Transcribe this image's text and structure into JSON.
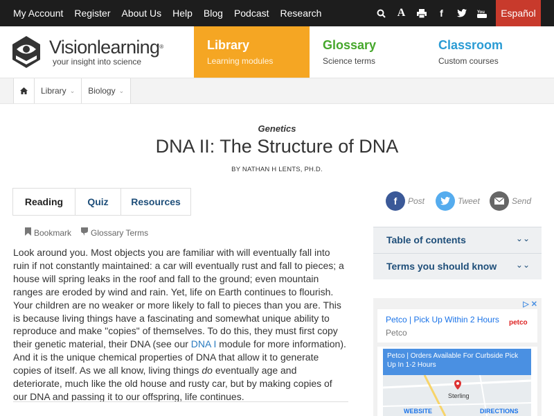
{
  "topnav": {
    "items": [
      "My Account",
      "Register",
      "About Us",
      "Help",
      "Blog",
      "Podcast",
      "Research"
    ],
    "icons": [
      "search-icon",
      "text-size-icon",
      "print-icon",
      "facebook-icon",
      "twitter-icon",
      "youtube-icon"
    ],
    "language_button": "Español"
  },
  "header": {
    "brand": "Visionlearning",
    "tagline": "your insight into science",
    "nav": [
      {
        "title": "Library",
        "subtitle": "Learning modules"
      },
      {
        "title": "Glossary",
        "subtitle": "Science terms"
      },
      {
        "title": "Classroom",
        "subtitle": "Custom courses"
      }
    ],
    "colors": {
      "library": "#f5a623",
      "glossary": "#45a72b",
      "classroom": "#2a9bd4"
    }
  },
  "breadcrumb": [
    "Library",
    "Biology"
  ],
  "article": {
    "category": "Genetics",
    "title": "DNA II: The Structure of DNA",
    "byline": "BY NATHAN H LENTS, PH.D.",
    "tabs": [
      "Reading",
      "Quiz",
      "Resources"
    ],
    "tools": [
      "Bookmark",
      "Glossary Terms"
    ],
    "body_before_link": "Look around you. Most objects you are familiar with will eventually fall into ruin if not constantly maintained: a car will eventually rust and fall to pieces; a house will spring leaks in the roof and fall to the ground; even mountain ranges are eroded by wind and rain. Yet, life on Earth continues to flourish. Your children are no weaker or more likely to fall to pieces than you are. This is because living things have a fascinating and somewhat unique ability to reproduce and make \"copies\" of themselves. To do this, they must first copy their genetic material, their DNA (see our ",
    "body_link": "DNA I",
    "body_mid": " module for more information). And it is the unique chemical properties of DNA that allow it to generate copies of itself. As we all know, living things ",
    "body_italic": "do",
    "body_end": " eventually age and deteriorate, much like the old house and rusty car, but by making copies of our DNA and passing it to our offspring, life continues."
  },
  "share": [
    "Post",
    "Tweet",
    "Send"
  ],
  "sidebar": {
    "accordions": [
      "Table of contents",
      "Terms you should know"
    ]
  },
  "ad": {
    "headline1": "Petco | Pick Up Within 2 Hours",
    "advertiser": "Petco",
    "logo_text": "petco",
    "headline2": "Petco | Orders Available For Curbside Pick Up In 1-2 Hours",
    "map_city": "Sterling",
    "website_label": "WEBSITE",
    "directions_label": "DIRECTIONS"
  }
}
